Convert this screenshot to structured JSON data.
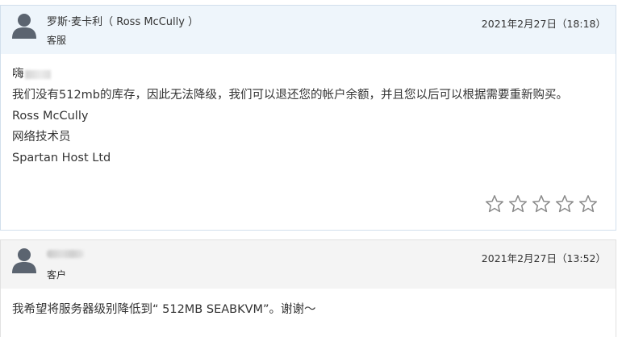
{
  "staff_reply": {
    "author": "罗斯·麦卡利（ Ross McCully ）",
    "role": "客服",
    "date": "2021年2月27日（18:18）",
    "greeting": "嗨",
    "message": "我们没有512mb的库存，因此无法降级，我们可以退还您的帐户余额，并且您以后可以根据需要重新购买。",
    "signature_name": "Ross McCully",
    "signature_title": "网络技术员",
    "signature_company": "Spartan Host Ltd",
    "rating": {
      "stars_total": 5,
      "stars_selected": 0,
      "icon": "star-outline-icon"
    }
  },
  "client_reply": {
    "role": "客户",
    "date": "2021年2月27日（13:52）",
    "message": "我希望将服务器级别降低到“ 512MB SEABKVM”。谢谢～"
  },
  "icons": {
    "avatar": "user-avatar-icon"
  },
  "colors": {
    "staff_header_bg": "#eef5fb",
    "client_header_bg": "#f4f4f4",
    "avatar": "#5b6470",
    "star_outline": "#8a8a8a"
  }
}
